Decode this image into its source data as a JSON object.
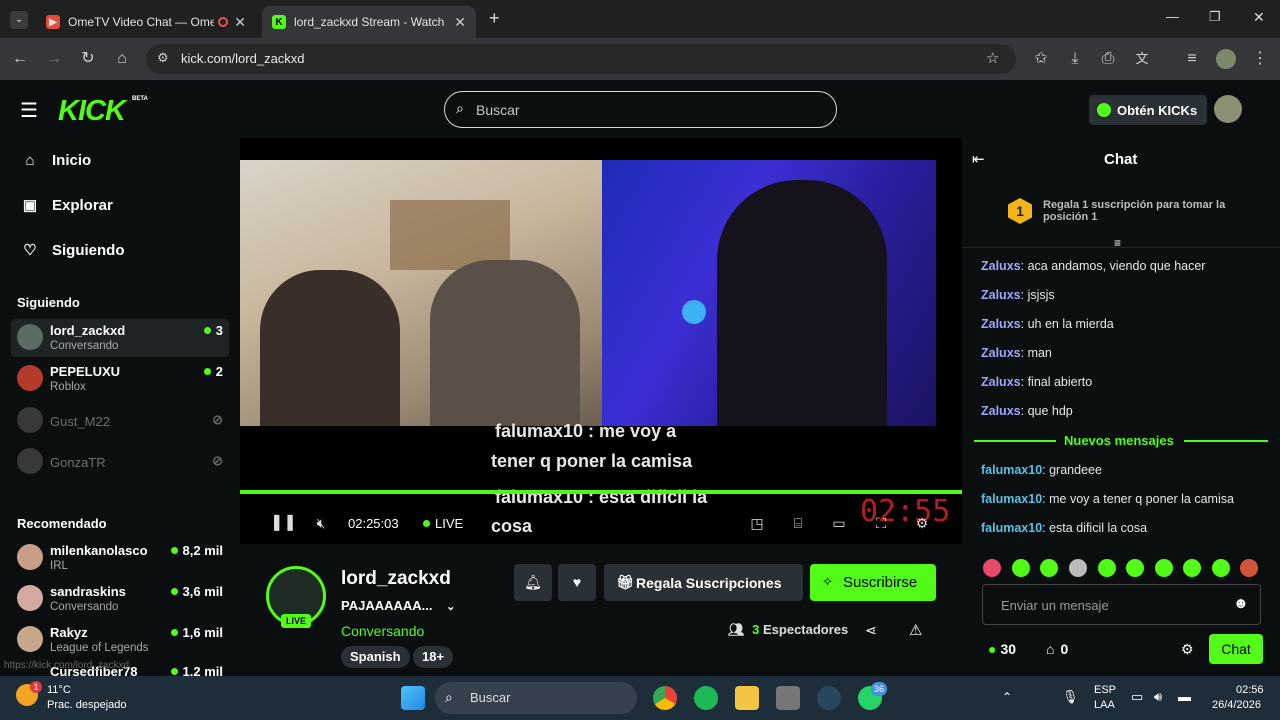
{
  "browser": {
    "tabs": [
      {
        "title": "OmeTV Video Chat — Ome",
        "active": false
      },
      {
        "title": "lord_zackxd Stream - Watch Liv",
        "active": true
      }
    ],
    "new_tab_symbol": "+",
    "url": "kick.com/lord_zackxd",
    "window_controls": {
      "minimize": "—",
      "maximize": "❐",
      "close": "✕"
    }
  },
  "header": {
    "logo": "KICK",
    "logo_badge": "BETA",
    "search_placeholder": "Buscar",
    "get_kicks_label": "Obtén KICKs"
  },
  "sidebar": {
    "nav": [
      {
        "label": "Inicio",
        "icon": "home-icon"
      },
      {
        "label": "Explorar",
        "icon": "compass-icon"
      },
      {
        "label": "Siguiendo",
        "icon": "heart-icon"
      }
    ],
    "following_title": "Siguiendo",
    "following": [
      {
        "name": "lord_zackxd",
        "sub": "Conversando",
        "count": "3",
        "online": true
      },
      {
        "name": "PEPELUXU",
        "sub": "Roblox",
        "count": "2",
        "online": true
      },
      {
        "name": "Gust_M22",
        "sub": "",
        "count": "",
        "online": false
      },
      {
        "name": "GonzaTR",
        "sub": "",
        "count": "",
        "online": false
      }
    ],
    "recommended_title": "Recomendado",
    "recommended": [
      {
        "name": "milenkanolasco",
        "sub": "IRL",
        "count": "8,2 mil"
      },
      {
        "name": "sandraskins",
        "sub": "Conversando",
        "count": "3,6 mil"
      },
      {
        "name": "Rakyz",
        "sub": "League of Legends",
        "count": "1,6 mil"
      },
      {
        "name": "Cursedfiber78",
        "sub": "",
        "count": "1,2 mil"
      }
    ],
    "status_url": "https://kick.com/lord_zackxd"
  },
  "player": {
    "captions": [
      "falumax10 : me voy a",
      "tener q poner la camisa",
      "falumax10 : esta dificil la",
      "cosa"
    ],
    "overlay_clock": "02:55",
    "time": "02:25:03",
    "live_label": "LIVE",
    "progress": 1.0
  },
  "channel": {
    "name": "lord_zackxd",
    "live_badge": "LIVE",
    "title": "PAJAAAAAA...",
    "category": "Conversando",
    "tags": [
      "Spanish",
      "18+"
    ],
    "gift_label": "Regala Suscripciones",
    "subscribe_label": "Suscribirse",
    "viewers_count": "3",
    "viewers_label": "Espectadores"
  },
  "chat": {
    "title": "Chat",
    "pinned_rank": "1",
    "pinned_text": "Regala 1 suscripción para tomar la posición 1",
    "messages_old": [
      {
        "user": "Zaluxs",
        "text": "aca andamos, viendo que hacer"
      },
      {
        "user": "Zaluxs",
        "text": "jsjsjs"
      },
      {
        "user": "Zaluxs",
        "text": "uh en la mierda"
      },
      {
        "user": "Zaluxs",
        "text": "man"
      },
      {
        "user": "Zaluxs",
        "text": "final abierto"
      },
      {
        "user": "Zaluxs",
        "text": "que hdp"
      }
    ],
    "new_messages_label": "Nuevos mensajes",
    "messages_new": [
      {
        "user": "falumax10",
        "text": "grandeee"
      },
      {
        "user": "falumax10",
        "text": "me voy a tener q poner la camisa"
      },
      {
        "user": "falumax10",
        "text": "esta dificil la cosa"
      }
    ],
    "input_placeholder": "Enviar un mensaje",
    "kicks_count": "30",
    "store_count": "0",
    "send_label": "Chat"
  },
  "taskbar": {
    "weather_temp": "11°C",
    "weather_desc": "Prac. despejado",
    "weather_badge": "1",
    "search_placeholder": "Buscar",
    "whatsapp_badge": "36",
    "lang_top": "ESP",
    "lang_bottom": "LAA",
    "clock_time": "02:56",
    "clock_date": "26/4/2026"
  },
  "colors": {
    "accent": "#53fc18",
    "background": "#0b0e0f",
    "panel": "#2a3136",
    "chat_user_old": "#9ea7ff",
    "chat_user_new": "#56c2e6"
  }
}
